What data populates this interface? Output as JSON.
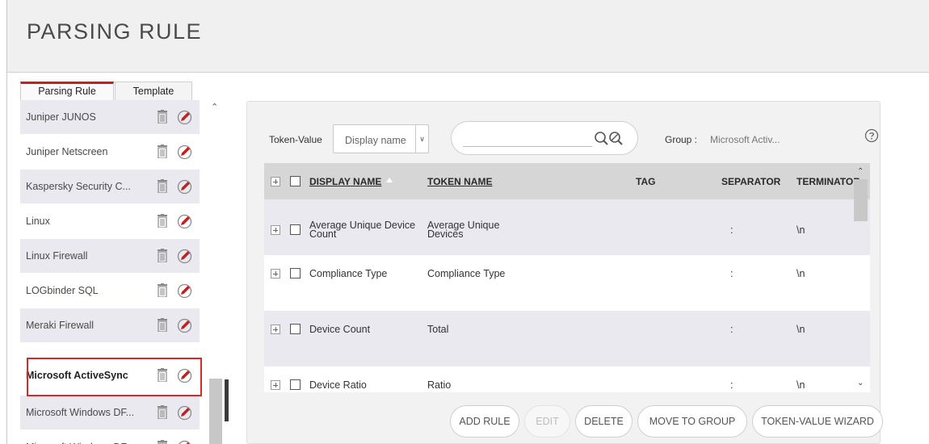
{
  "page_title": "PARSING RULE",
  "tabs": [
    {
      "label": "Parsing Rule",
      "active": true
    },
    {
      "label": "Template",
      "active": false
    }
  ],
  "rule_list": [
    {
      "label": "Juniper JUNOS"
    },
    {
      "label": "Juniper Netscreen"
    },
    {
      "label": "Kaspersky Security C..."
    },
    {
      "label": "Linux"
    },
    {
      "label": "Linux Firewall"
    },
    {
      "label": "LOGbinder SQL"
    },
    {
      "label": "Meraki Firewall"
    },
    {
      "label": "Microsoft ActiveSync",
      "selected": true
    },
    {
      "label": "Microsoft Windows DF..."
    },
    {
      "label": "Microsoft Windows DF..."
    }
  ],
  "toolbar": {
    "token_value_label": "Token-Value",
    "token_value_select": "Display name",
    "search_placeholder": "",
    "group_label": "Group :",
    "group_value": "Microsoft Activ..."
  },
  "table": {
    "columns": [
      "DISPLAY NAME",
      "TOKEN NAME",
      "TAG",
      "SEPARATOR",
      "TERMINATOR"
    ],
    "sort_column": "DISPLAY NAME",
    "rows": [
      {
        "display_name": "Average Unique Device Count",
        "token_name": "Average Unique Devices",
        "tag": "",
        "separator": ":",
        "terminator": "\\n"
      },
      {
        "display_name": "Compliance Type",
        "token_name": "Compliance Type",
        "tag": "",
        "separator": ":",
        "terminator": "\\n"
      },
      {
        "display_name": "Device Count",
        "token_name": "Total",
        "tag": "",
        "separator": ":",
        "terminator": "\\n"
      },
      {
        "display_name": "Device Ratio",
        "token_name": "Ratio",
        "tag": "",
        "separator": ":",
        "terminator": "\\n"
      }
    ]
  },
  "buttons": {
    "add_rule": "ADD RULE",
    "edit": "EDIT",
    "delete": "DELETE",
    "move_to_group": "MOVE TO GROUP",
    "token_value_wizard": "TOKEN-VALUE WIZARD"
  },
  "colors": {
    "accent_red": "#c81e1e",
    "edit_icon_red": "#c81e1e",
    "header_bg": "#f0f0f0",
    "table_header_bg": "#d6d6d6",
    "row_alt_bg": "#e9e9ef"
  }
}
